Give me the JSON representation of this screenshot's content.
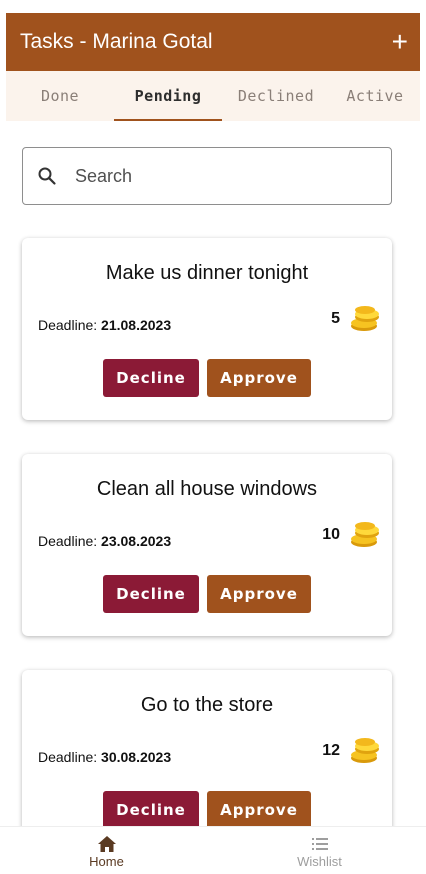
{
  "appbar": {
    "title": "Tasks - Marina Gotal",
    "add_label": "+"
  },
  "tabs": [
    {
      "label": "Done"
    },
    {
      "label": "Pending"
    },
    {
      "label": "Declined"
    },
    {
      "label": "Active"
    }
  ],
  "active_tab": "Pending",
  "search": {
    "placeholder": "Search",
    "value": ""
  },
  "deadline_label": "Deadline: ",
  "tasks": [
    {
      "title": "Make us dinner tonight",
      "deadline": "21.08.2023",
      "reward": "5",
      "decline_label": "Decline",
      "approve_label": "Approve"
    },
    {
      "title": "Clean all house windows",
      "deadline": "23.08.2023",
      "reward": "10",
      "decline_label": "Decline",
      "approve_label": "Approve"
    },
    {
      "title": "Go to the store",
      "deadline": "30.08.2023",
      "reward": "12",
      "decline_label": "Decline",
      "approve_label": "Approve"
    }
  ],
  "bottom_nav": [
    {
      "label": "Home",
      "icon": "home-icon"
    },
    {
      "label": "Wishlist",
      "icon": "list-icon"
    }
  ],
  "colors": {
    "primary": "#A0521D",
    "decline": "#8B1A36",
    "tab_bg": "#FBF3EC"
  }
}
